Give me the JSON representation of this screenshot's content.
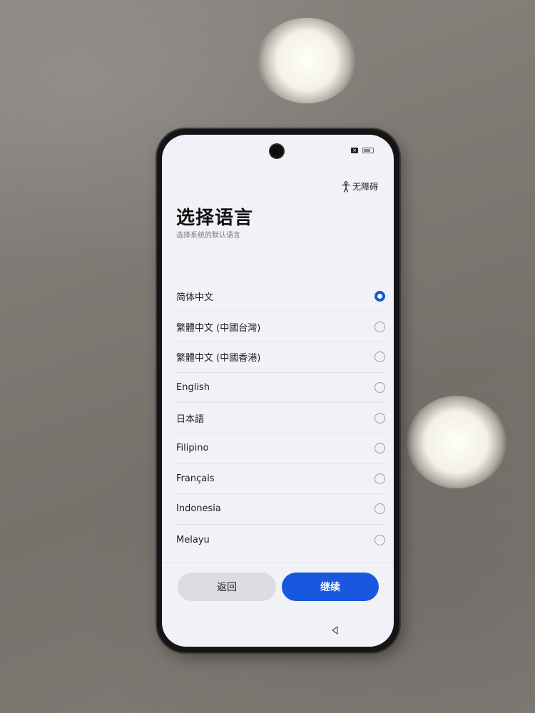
{
  "status_bar": {
    "icons": [
      "sim-icon",
      "battery-icon"
    ]
  },
  "accessibility": {
    "icon": "accessibility-person-icon",
    "label": "无障碍"
  },
  "header": {
    "title": "选择语言",
    "subtitle": "选择系统的默认语言"
  },
  "languages": [
    {
      "label": "简体中文",
      "selected": true
    },
    {
      "label": "繁體中文 (中國台灣)",
      "selected": false
    },
    {
      "label": "繁體中文 (中國香港)",
      "selected": false
    },
    {
      "label": "English",
      "selected": false
    },
    {
      "label": "日本語",
      "selected": false
    },
    {
      "label": "Filipino",
      "selected": false
    },
    {
      "label": "Français",
      "selected": false
    },
    {
      "label": "Indonesia",
      "selected": false
    },
    {
      "label": "Melayu",
      "selected": false
    }
  ],
  "buttons": {
    "back_label": "返回",
    "continue_label": "继续"
  },
  "nav": {
    "back_icon": "triangle-back-icon"
  },
  "colors": {
    "accent": "#1858e0",
    "screen_background": "#f1f2f7",
    "secondary_button": "#dcdde2"
  }
}
